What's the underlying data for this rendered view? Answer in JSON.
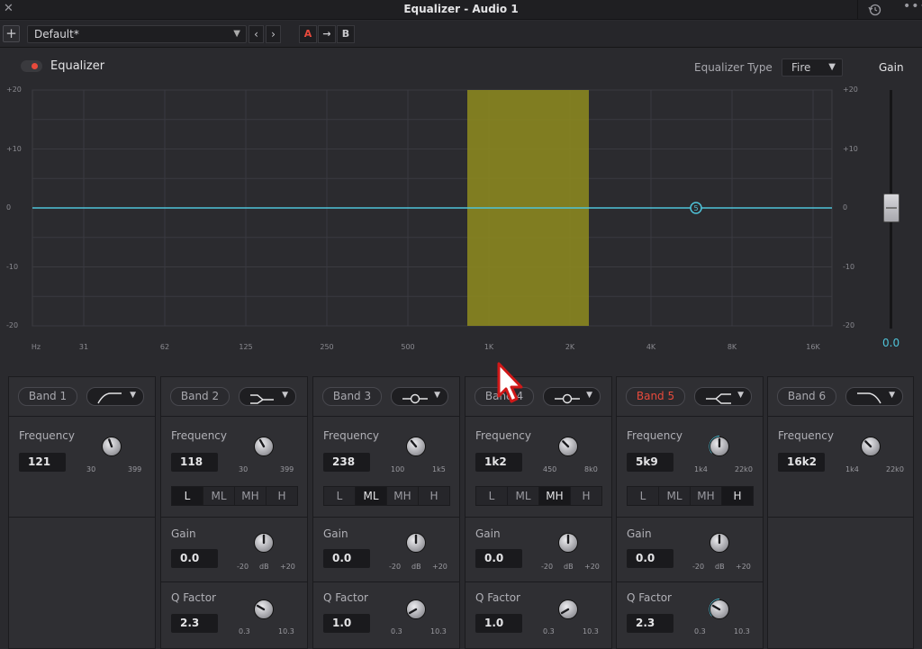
{
  "window": {
    "title": "Equalizer - Audio 1"
  },
  "preset": {
    "name": "Default*",
    "a_label": "A",
    "copy_label": "→",
    "b_label": "B"
  },
  "header": {
    "eq_label": "Equalizer",
    "eq_type_label": "Equalizer Type",
    "eq_type_value": "Fire",
    "gain_label": "Gain"
  },
  "graph": {
    "db_ticks": [
      "+20",
      "+10",
      "0",
      "-10",
      "-20"
    ],
    "hz_ticks": [
      "Hz",
      "31",
      "62",
      "125",
      "250",
      "500",
      "1K",
      "2K",
      "4K",
      "8K",
      "16K"
    ],
    "highlight_color": "#8f8c1e",
    "curve_color": "#4fc3d9",
    "node_label": "5"
  },
  "gain": {
    "value": "0.0"
  },
  "bands": [
    {
      "name": "Band 1",
      "active": false,
      "shape": "high-pass",
      "freq_label": "Frequency",
      "freq": "121",
      "freq_min": "30",
      "freq_max": "399"
    },
    {
      "name": "Band 2",
      "active": false,
      "shape": "low-shelf",
      "freq_label": "Frequency",
      "freq": "118",
      "freq_min": "30",
      "freq_max": "399",
      "mode": "L",
      "gain_label": "Gain",
      "gain": "0.0",
      "gain_min": "-20",
      "gain_unit": "dB",
      "gain_max": "+20",
      "q_label": "Q Factor",
      "q": "2.3",
      "q_min": "0.3",
      "q_max": "10.3"
    },
    {
      "name": "Band 3",
      "active": false,
      "shape": "bell",
      "freq_label": "Frequency",
      "freq": "238",
      "freq_min": "100",
      "freq_max": "1k5",
      "mode": "ML",
      "gain_label": "Gain",
      "gain": "0.0",
      "gain_min": "-20",
      "gain_unit": "dB",
      "gain_max": "+20",
      "q_label": "Q Factor",
      "q": "1.0",
      "q_min": "0.3",
      "q_max": "10.3"
    },
    {
      "name": "Band 4",
      "active": false,
      "shape": "bell",
      "freq_label": "Frequency",
      "freq": "1k2",
      "freq_min": "450",
      "freq_max": "8k0",
      "mode": "MH",
      "gain_label": "Gain",
      "gain": "0.0",
      "gain_min": "-20",
      "gain_unit": "dB",
      "gain_max": "+20",
      "q_label": "Q Factor",
      "q": "1.0",
      "q_min": "0.3",
      "q_max": "10.3"
    },
    {
      "name": "Band 5",
      "active": true,
      "shape": "high-shelf",
      "freq_label": "Frequency",
      "freq": "5k9",
      "freq_min": "1k4",
      "freq_max": "22k0",
      "mode": "H",
      "gain_label": "Gain",
      "gain": "0.0",
      "gain_min": "-20",
      "gain_unit": "dB",
      "gain_max": "+20",
      "q_label": "Q Factor",
      "q": "2.3",
      "q_min": "0.3",
      "q_max": "10.3"
    },
    {
      "name": "Band 6",
      "active": false,
      "shape": "low-pass",
      "freq_label": "Frequency",
      "freq": "16k2",
      "freq_min": "1k4",
      "freq_max": "22k0"
    }
  ],
  "mode_options": [
    "L",
    "ML",
    "MH",
    "H"
  ]
}
